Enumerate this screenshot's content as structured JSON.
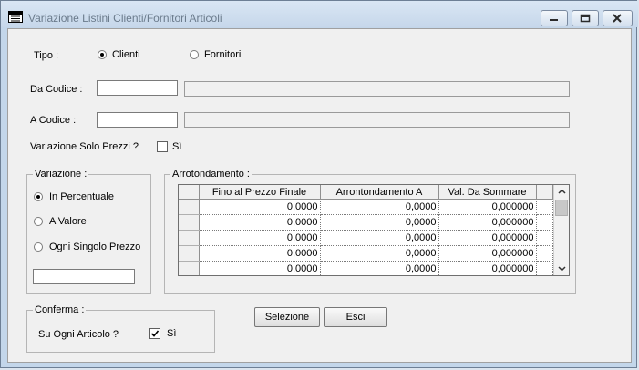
{
  "window": {
    "title": "Variazione  Listini Clienti/Fornitori  Articoli"
  },
  "tipo": {
    "label": "Tipo :",
    "options": [
      {
        "label": "Clienti",
        "selected": true
      },
      {
        "label": "Fornitori",
        "selected": false
      }
    ]
  },
  "da_codice": {
    "label": "Da Codice :",
    "value": "",
    "description": ""
  },
  "a_codice": {
    "label": "A Codice :",
    "value": "",
    "description": ""
  },
  "solo_prezzi": {
    "label": "Variazione Solo Prezzi ?",
    "checkbox_label": "Sì",
    "checked": false
  },
  "variazione": {
    "title": "Variazione :",
    "options": [
      {
        "label": "In Percentuale",
        "selected": true
      },
      {
        "label": "A Valore",
        "selected": false
      },
      {
        "label": "Ogni Singolo Prezzo",
        "selected": false
      }
    ],
    "value": ""
  },
  "arrotondamento": {
    "title": "Arrotondamento :",
    "columns": [
      "Fino al Prezzo Finale",
      "Arrontondamento  A",
      "Val. Da Sommare"
    ],
    "rows": [
      [
        "0,0000",
        "0,0000",
        "0,000000"
      ],
      [
        "0,0000",
        "0,0000",
        "0,000000"
      ],
      [
        "0,0000",
        "0,0000",
        "0,000000"
      ],
      [
        "0,0000",
        "0,0000",
        "0,000000"
      ],
      [
        "0,0000",
        "0,0000",
        "0,000000"
      ]
    ]
  },
  "conferma": {
    "title": "Conferma :",
    "label": "Su Ogni Articolo ?",
    "checkbox_label": "Sì",
    "checked": true
  },
  "buttons": {
    "selezione": "Selezione",
    "esci": "Esci"
  }
}
